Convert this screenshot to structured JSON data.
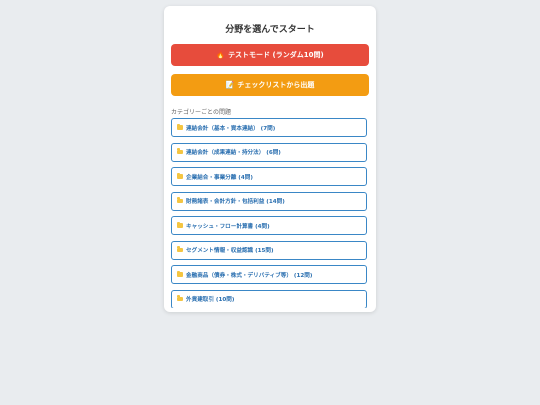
{
  "page": {
    "title": "分野を選んでスタート"
  },
  "actions": {
    "test_mode": {
      "icon": "fire-icon",
      "label": "テストモード (ランダム10問)",
      "color": "#e74c3c"
    },
    "checklist": {
      "icon": "memo-icon",
      "label": "チェックリストから出題",
      "color": "#f39c12"
    }
  },
  "categories": {
    "section_label": "カテゴリーごとの問題",
    "items": [
      {
        "label": "連結会計（基本・資本連結） (7問)"
      },
      {
        "label": "連結会計（成果連結・持分法） (6問)"
      },
      {
        "label": "企業結合・事業分離 (4問)"
      },
      {
        "label": "財務諸表・会計方針・包括利益 (14問)"
      },
      {
        "label": "キャッシュ・フロー計算書 (4問)"
      },
      {
        "label": "セグメント情報・収益認識 (15問)"
      },
      {
        "label": "金融商品（債券・株式・デリバティブ等） (12問)"
      },
      {
        "label": "外貨建取引 (10問)"
      }
    ]
  },
  "colors": {
    "accent_border": "#3a87c6",
    "link_text": "#2a6fb0",
    "background": "#e9ecef"
  }
}
